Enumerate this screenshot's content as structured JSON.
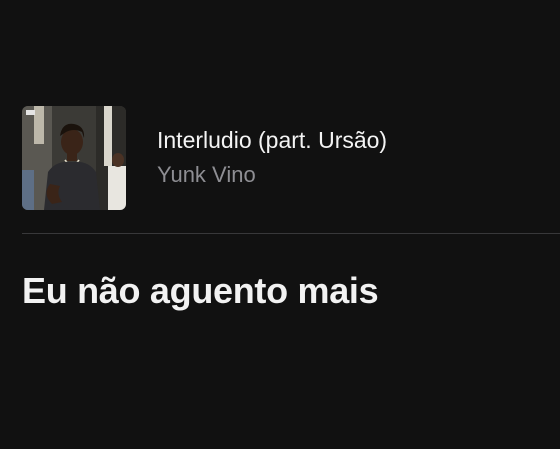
{
  "track": {
    "title": "Interludio (part. Ursão)",
    "artist": "Yunk Vino",
    "artwork_icon": "album-artwork-image"
  },
  "lyrics": {
    "current_line": "Eu não aguento mais"
  },
  "colors": {
    "background": "#111111",
    "primary_text": "#f4f4f4",
    "secondary_text": "#8e8e93",
    "divider": "#38383a"
  }
}
